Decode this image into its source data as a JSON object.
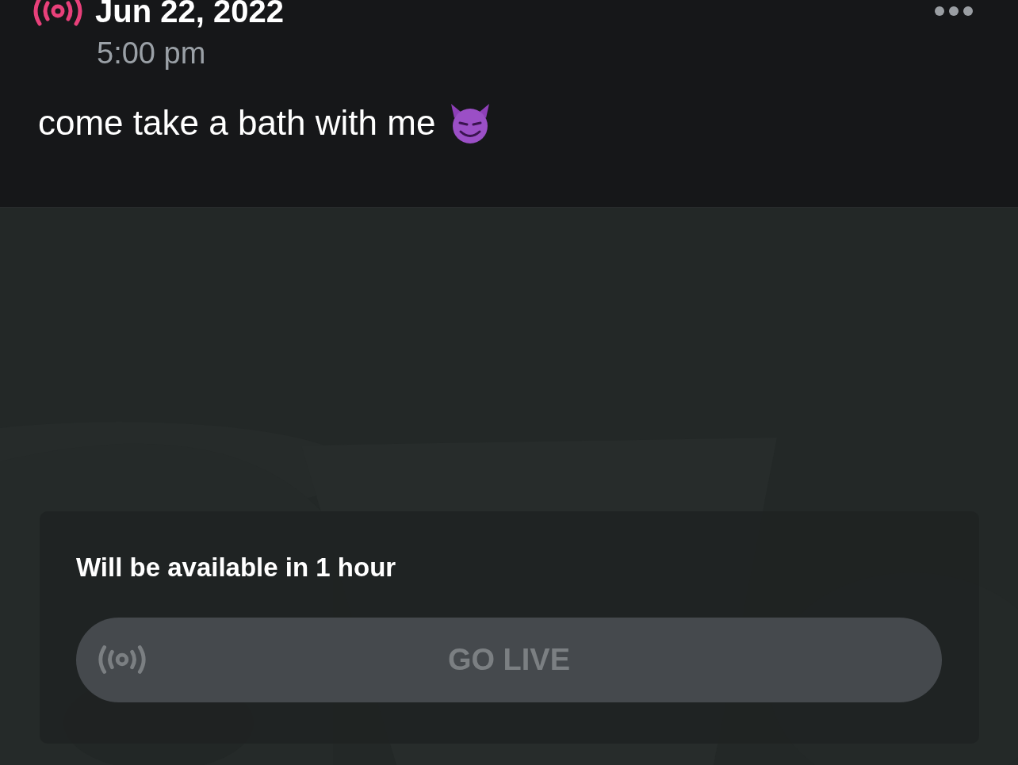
{
  "post": {
    "date": "Jun 22, 2022",
    "time": "5:00 pm",
    "text": "come take a bath with me"
  },
  "media": {
    "kind": "picture",
    "notice": "Will be available in 1 hour",
    "button": {
      "label": "GO LIVE",
      "disabled": true
    }
  }
}
